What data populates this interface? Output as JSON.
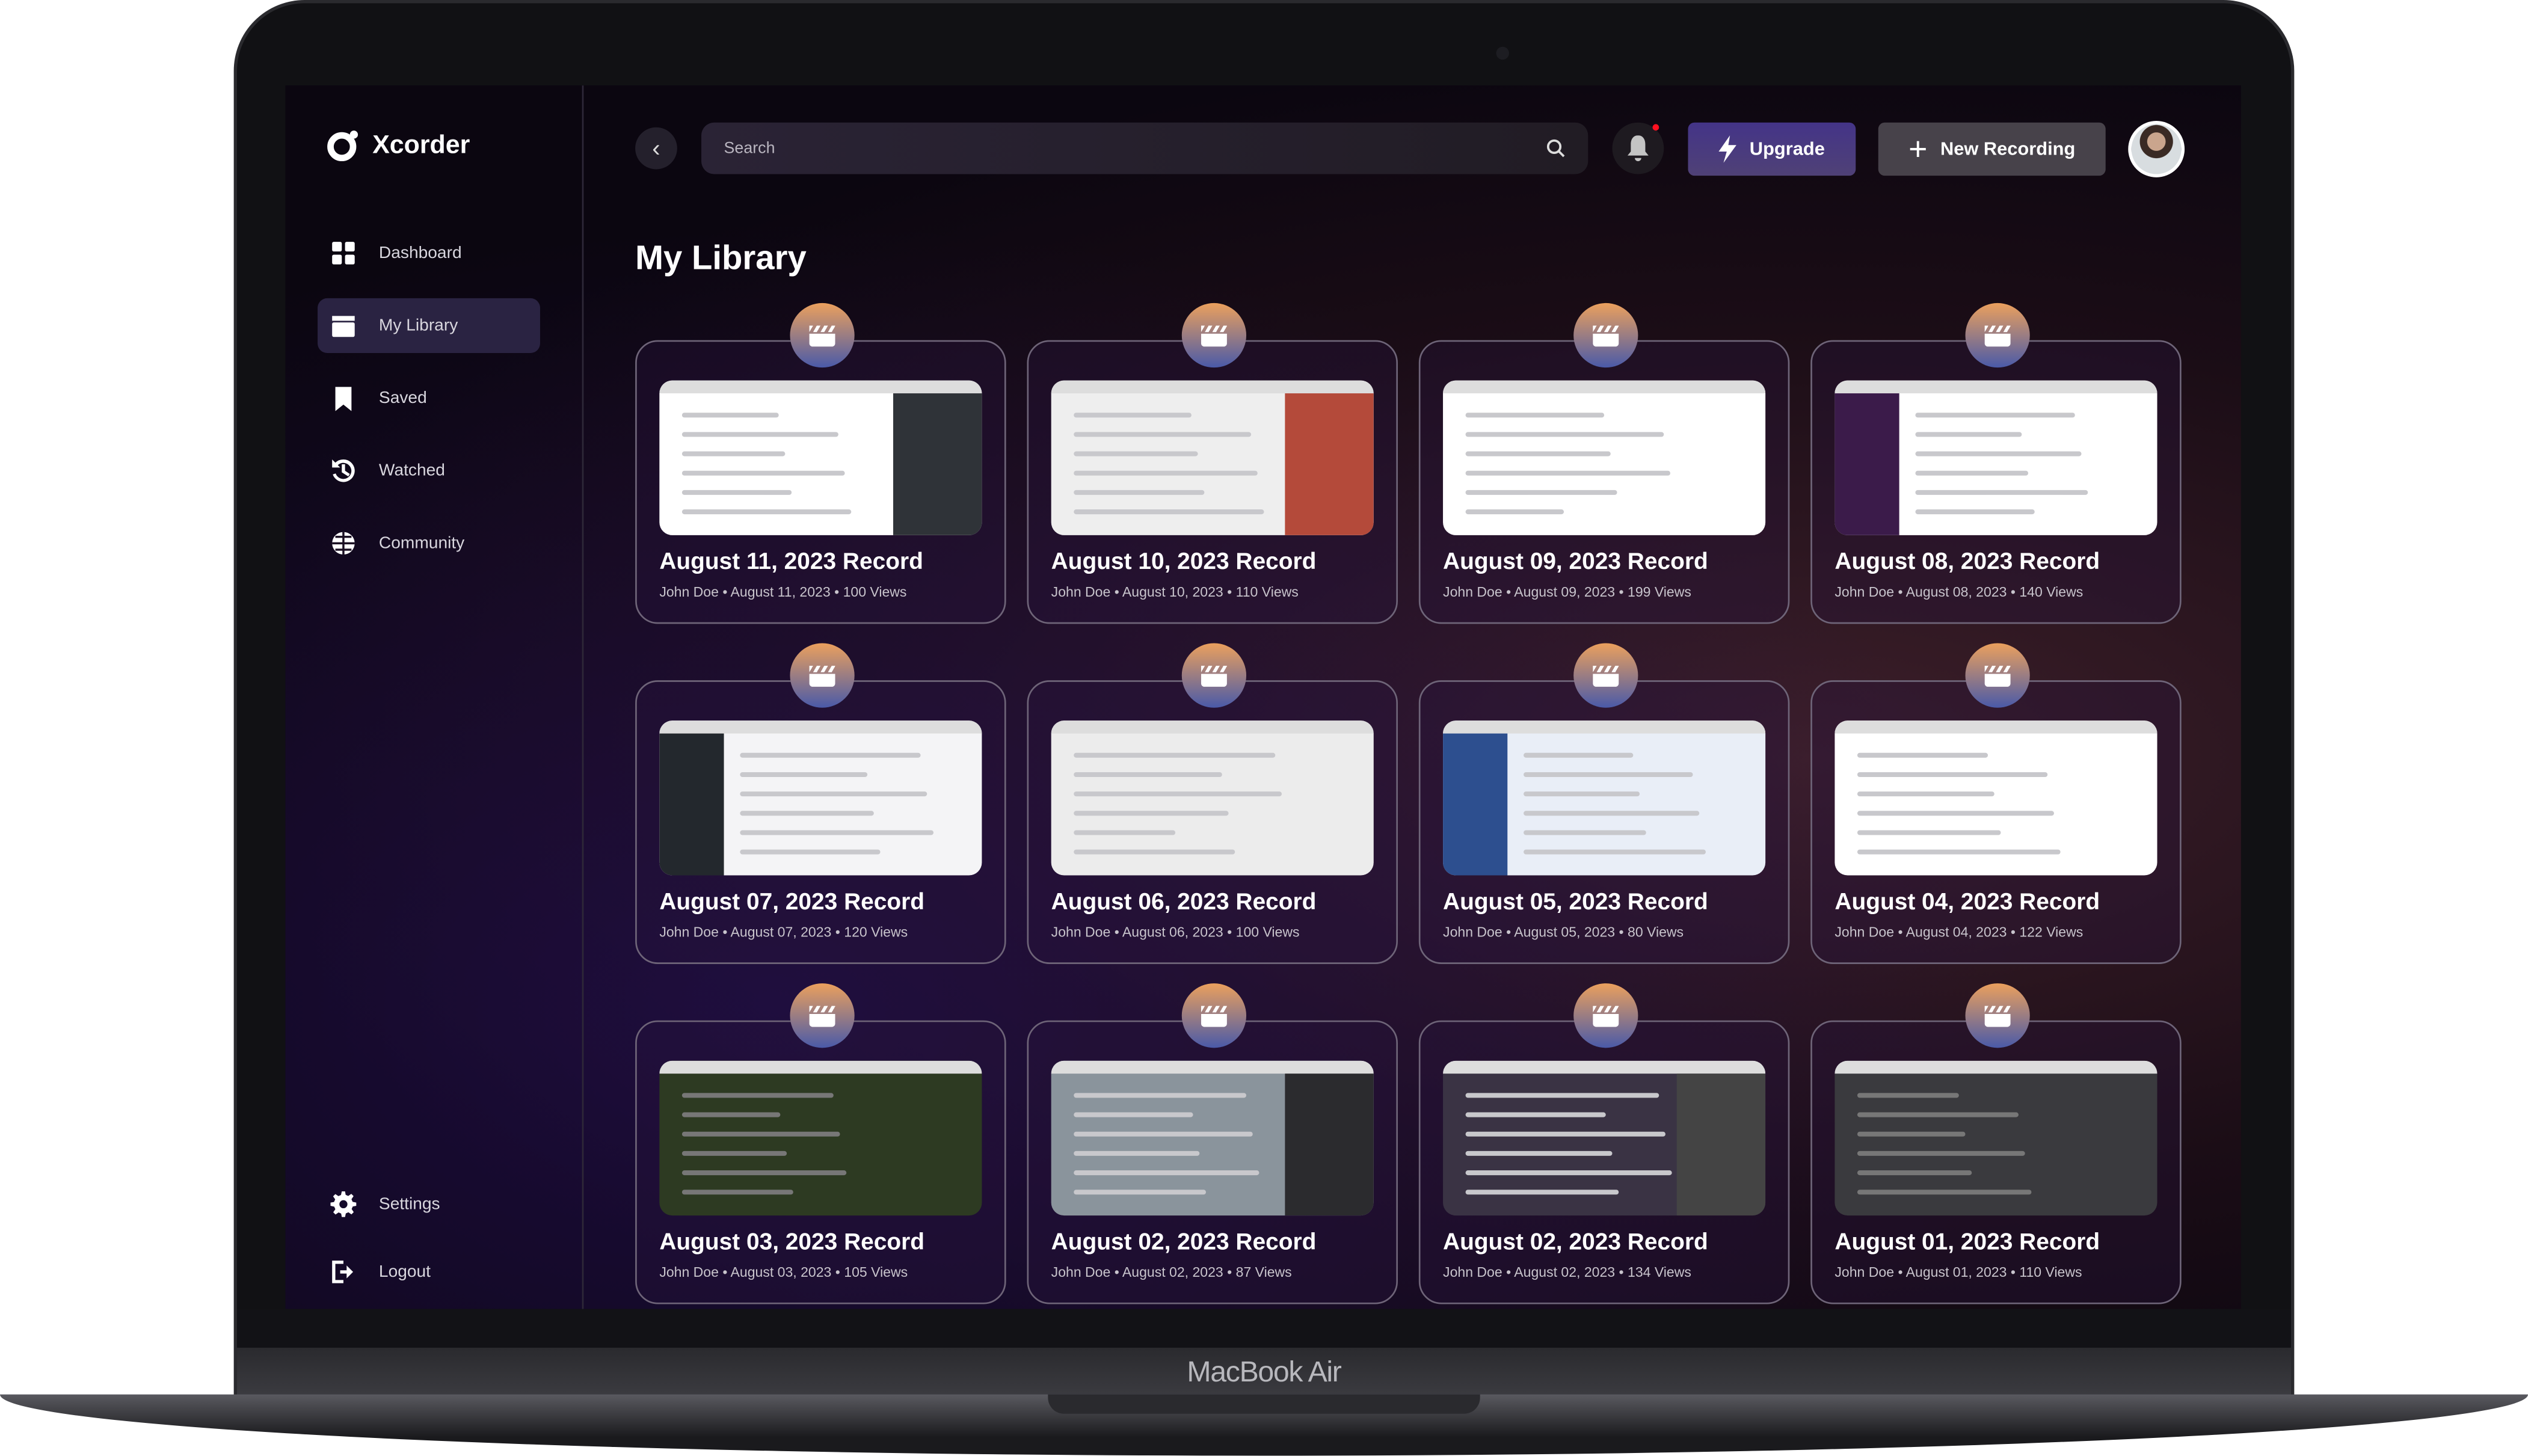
{
  "app": {
    "name": "Xcorder"
  },
  "sidebar": {
    "items": [
      {
        "label": "Dashboard",
        "icon": "grid-icon"
      },
      {
        "label": "My Library",
        "icon": "clapperboard-icon",
        "active": true
      },
      {
        "label": "Saved",
        "icon": "bookmark-icon"
      },
      {
        "label": "Watched",
        "icon": "history-icon"
      },
      {
        "label": "Community",
        "icon": "globe-icon"
      }
    ],
    "bottom": [
      {
        "label": "Settings",
        "icon": "gear-icon"
      },
      {
        "label": "Logout",
        "icon": "logout-icon"
      }
    ]
  },
  "header": {
    "search_placeholder": "Search",
    "upgrade_label": "Upgrade",
    "new_recording_label": "New Recording",
    "has_notification": true
  },
  "page": {
    "title": "My Library"
  },
  "colors": {
    "accent": "#443488",
    "badge_top": "#eba05d",
    "badge_bottom": "#4a5aa8",
    "notification": "#ff1020"
  },
  "recordings": [
    {
      "title": "August 11, 2023 Record",
      "author": "John Doe",
      "date": "August 11, 2023",
      "views": "100 Views"
    },
    {
      "title": "August 10, 2023 Record",
      "author": "John Doe",
      "date": "August 10, 2023",
      "views": "110 Views"
    },
    {
      "title": "August 09, 2023 Record",
      "author": "John Doe",
      "date": "August 09, 2023",
      "views": "199 Views"
    },
    {
      "title": "August 08, 2023 Record",
      "author": "John Doe",
      "date": "August 08, 2023",
      "views": "140 Views"
    },
    {
      "title": "August 07, 2023 Record",
      "author": "John Doe",
      "date": "August 07, 2023",
      "views": "120 Views"
    },
    {
      "title": "August 06, 2023 Record",
      "author": "John Doe",
      "date": "August 06, 2023",
      "views": "100 Views"
    },
    {
      "title": "August 05, 2023 Record",
      "author": "John Doe",
      "date": "August 05, 2023",
      "views": "80 Views"
    },
    {
      "title": "August 04, 2023 Record",
      "author": "John Doe",
      "date": "August 04, 2023",
      "views": "122 Views"
    },
    {
      "title": "August 03, 2023 Record",
      "author": "John Doe",
      "date": "August 03, 2023",
      "views": "105 Views"
    },
    {
      "title": "August 02, 2023 Record",
      "author": "John Doe",
      "date": "August 02, 2023",
      "views": "87 Views"
    },
    {
      "title": "August 02, 2023 Record",
      "author": "John Doe",
      "date": "August 02, 2023",
      "views": "134 Views"
    },
    {
      "title": "August 01, 2023 Record",
      "author": "John Doe",
      "date": "August 01, 2023",
      "views": "110 Views"
    }
  ],
  "device": {
    "label": "MacBook Air"
  }
}
